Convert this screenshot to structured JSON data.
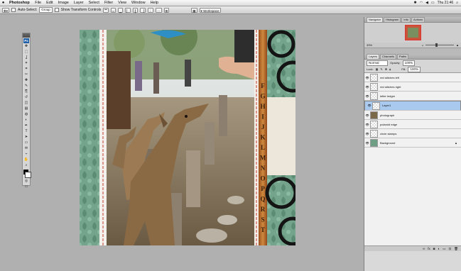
{
  "menubar": {
    "apple": "",
    "app_name": "Photoshop",
    "items": [
      "File",
      "Edit",
      "Image",
      "Layer",
      "Select",
      "Filter",
      "View",
      "Window",
      "Help"
    ],
    "clock": "Thu 21:46"
  },
  "options_bar": {
    "auto_select_label": "Auto-Select:",
    "auto_select_value": "Group",
    "transform_label": "Show Transform Controls",
    "workspace_label": "Workspace"
  },
  "tools": {
    "ps_label": "Ps",
    "icons": [
      "move-tool",
      "marquee-tool",
      "lasso-tool",
      "magic-wand-tool",
      "crop-tool",
      "slice-tool",
      "healing-brush-tool",
      "brush-tool",
      "clone-stamp-tool",
      "history-brush-tool",
      "eraser-tool",
      "gradient-tool",
      "blur-tool",
      "dodge-tool",
      "pen-tool",
      "type-tool",
      "path-selection-tool",
      "shape-tool",
      "notes-tool",
      "eyedropper-tool",
      "hand-tool",
      "zoom-tool"
    ],
    "glyphs": [
      "✥",
      "⬚",
      "ʆ",
      "✶",
      "⌗",
      "✂",
      "✚",
      "✎",
      "⎘",
      "↺",
      "◫",
      "▤",
      "◍",
      "◐",
      "✒",
      "T",
      "➤",
      "▭",
      "✉",
      "⌁",
      "✋",
      "⌕"
    ]
  },
  "document": {
    "letters": [
      "F",
      "G",
      "H",
      "I",
      "J",
      "K",
      "L",
      "M",
      "N",
      "O",
      "P",
      "Q",
      "R",
      "S",
      "T"
    ]
  },
  "navigator": {
    "tabs": [
      "Navigator",
      "Histogram",
      "Info",
      "Actions"
    ],
    "zoom": "33%"
  },
  "layers": {
    "tabs": [
      "Layers",
      "Channels",
      "Paths"
    ],
    "blend_mode": "Normal",
    "opacity_label": "Opacity:",
    "opacity_value": "100%",
    "lock_label": "Lock:",
    "fill_label": "Fill:",
    "fill_value": "100%",
    "items": [
      {
        "name": "red stitches left",
        "selected": false
      },
      {
        "name": "red stitches right",
        "selected": false
      },
      {
        "name": "letter ledger",
        "selected": false
      },
      {
        "name": "Layer1",
        "selected": true
      },
      {
        "name": "photograph",
        "selected": false
      },
      {
        "name": "polaroid edge",
        "selected": false
      },
      {
        "name": "circle stamps",
        "selected": false
      },
      {
        "name": "Background",
        "selected": false
      }
    ]
  },
  "colors": {
    "workspace_bg": "#b0b0b0",
    "selection": "#a9c9ef",
    "teal_paper": "#6f9e86",
    "leather": "#b86a2a"
  }
}
